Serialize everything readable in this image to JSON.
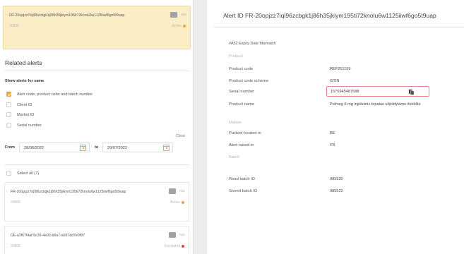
{
  "left": {
    "selected_card": {
      "title": "FR-20opjzz7iql96zcbgk1j86h35jkiym195ti72knolu6w1125iiwf6go5t9uap",
      "sub": "20805",
      "badge": "A52",
      "status": "Active"
    },
    "section_title": "Related alerts",
    "show_alerts_label": "Show alerts for same",
    "options": [
      {
        "label": "Alert code, product code and batch number",
        "checked": true
      },
      {
        "label": "Client ID",
        "checked": false
      },
      {
        "label": "Market ID",
        "checked": false
      },
      {
        "label": "Serial number",
        "checked": false
      }
    ],
    "clear_label": "Clear",
    "from_label": "From",
    "from_date": "28/06/2022",
    "to_label": "to",
    "to_date": "29/07/2022",
    "select_all_label": "Select all (7)",
    "cards": [
      {
        "title": "FR-20opjzz7iql96zcbgk1j86h35jkiym195ti72knolu6w1125iiwf6go5t9uap",
        "sub": "20805",
        "badge": "A52",
        "status": "Active",
        "status_color": "#f2a53a"
      },
      {
        "title": "DE-a2f67f4af-5c39-4e03-b6a7-a667dd7e0f97",
        "sub": "20805",
        "badge": "A52",
        "status": "Escalated",
        "status_color": "#e04a4a"
      }
    ]
  },
  "right": {
    "heading": "Alert ID FR-20opjzz7iql96zcbgk1j86h35jkiym195ti72knolu6w1125iiwf6go5t9uap",
    "alert_code": "#A52  Expiry Date Mismatch",
    "product_group": "Product",
    "product_code_label": "Product code",
    "product_code": "REF251159",
    "scheme_label": "Product code scheme",
    "scheme": "GTIN",
    "serial_label": "Serial number",
    "serial": "1576945487688",
    "product_name_label": "Product name",
    "product_name": "Pelmeg 6 mg injekcinis tirpalas užpildytame švirkšte",
    "market_group": "Market",
    "packed_label": "Packed located in",
    "packed": "BE",
    "raised_label": "Alert raised in",
    "raised": "FR",
    "batch_group": "Batch",
    "read_batch_label": "Read batch ID",
    "read_batch": "985520",
    "stored_batch_label": "Stored batch ID",
    "stored_batch": "985522"
  },
  "colors": {
    "accent": "#f2a53a",
    "selected_card_bg": "#fbeec7",
    "highlight_border": "#e9838a",
    "escalated": "#e04a4a"
  }
}
